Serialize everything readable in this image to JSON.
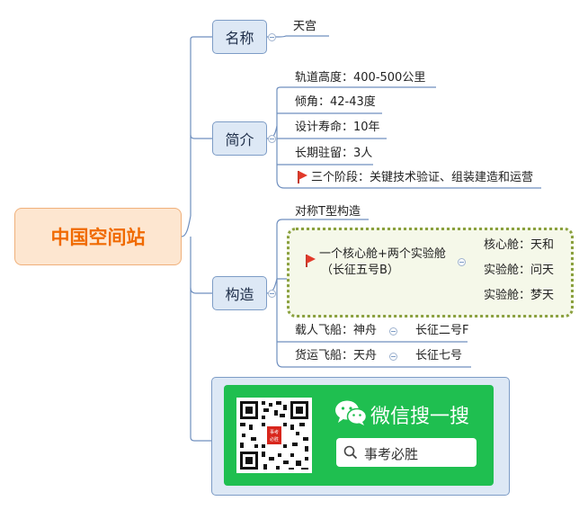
{
  "root": "中国空间站",
  "branches": {
    "name": {
      "label": "名称",
      "leaves": [
        "天宫"
      ]
    },
    "intro": {
      "label": "简介",
      "leaves": [
        "轨道高度：400-500公里",
        "倾角：42-43度",
        "设计寿命：10年",
        "长期驻留：3人",
        "三个阶段：关键技术验证、组装建造和运营"
      ]
    },
    "structure": {
      "label": "构造",
      "top_leaf": "对称T型构造",
      "cluster": {
        "line1": "一个核心舱+两个实验舱",
        "line2": "（长征五号B）",
        "children": [
          "核心舱：天和",
          "实验舱：问天",
          "实验舱：梦天"
        ]
      },
      "crewed": {
        "label": "载人飞船：神舟",
        "rocket": "长征二号F"
      },
      "cargo": {
        "label": "货运飞船：天舟",
        "rocket": "长征七号"
      }
    }
  },
  "wechat": {
    "title": "微信搜一搜",
    "search_text": "事考必胜",
    "badge_text": "事考 必胜"
  },
  "colors": {
    "root_text": "#f06a00",
    "root_fill": "#fde6d0",
    "branch_fill": "#dde8f5",
    "line": "#6f8fbf",
    "wechat_green": "#1fbf50",
    "cluster_border": "#8aa03e",
    "flag": "#e23a2a"
  }
}
